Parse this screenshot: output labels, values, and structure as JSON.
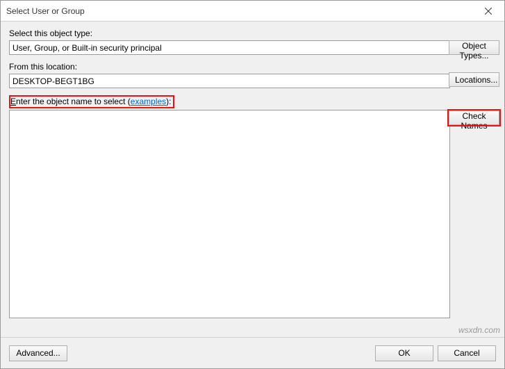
{
  "window": {
    "title": "Select User or Group"
  },
  "labels": {
    "object_type": "Select this object type:",
    "location": "From this location:",
    "enter_prefix": "E",
    "enter_rest": "nter the object name to select",
    "examples": "examples"
  },
  "values": {
    "object_type": "User, Group, or Built-in security principal",
    "location": "DESKTOP-BEGT1BG",
    "object_name": ""
  },
  "buttons": {
    "object_types": "Object Types...",
    "locations": "Locations...",
    "check_names": "Check Names",
    "advanced": "Advanced...",
    "ok": "OK",
    "cancel": "Cancel"
  },
  "watermark": "wsxdn.com"
}
